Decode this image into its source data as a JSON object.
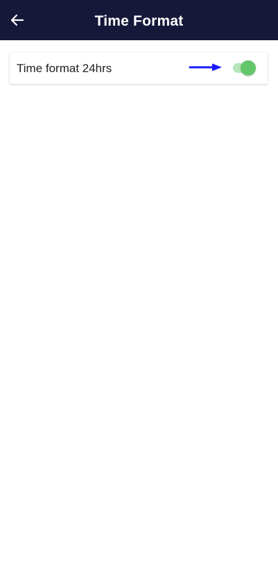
{
  "app_bar": {
    "title": "Time Format",
    "back_icon": "arrow-left-icon",
    "background_color": "#151838"
  },
  "settings": [
    {
      "label": "Time format 24hrs",
      "toggle_on": true,
      "toggle_color": "#62c768",
      "annotation_icon": "arrow-right-icon",
      "annotation_color": "#1a1aff"
    }
  ]
}
